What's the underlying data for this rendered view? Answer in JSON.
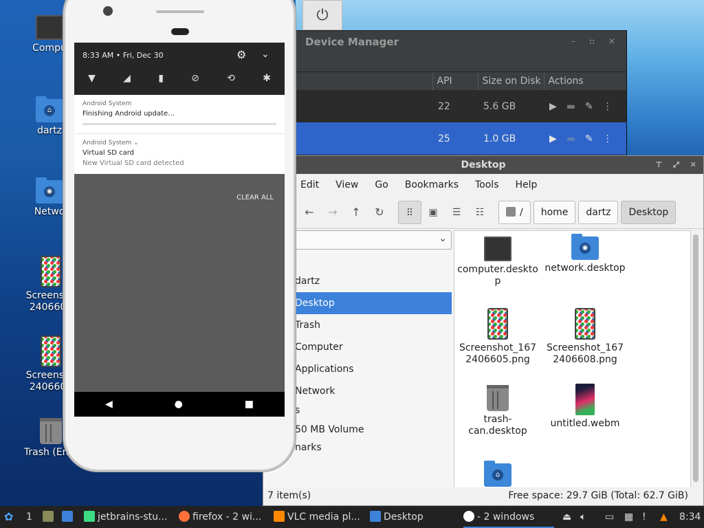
{
  "desktop": {
    "icons": [
      {
        "label": "Compu",
        "kind": "computer"
      },
      {
        "label": "dartz",
        "kind": "home-folder"
      },
      {
        "label": "Netwo",
        "kind": "network-folder"
      },
      {
        "label": "Screensho",
        "label2": "2406605",
        "kind": "image"
      },
      {
        "label": "Screensho",
        "label2": "2406608",
        "kind": "image"
      },
      {
        "label": "Trash (Emp",
        "kind": "trash"
      }
    ]
  },
  "device_manager": {
    "title": "Device Manager",
    "columns": [
      "API",
      "Size on Disk",
      "Actions"
    ],
    "rows": [
      {
        "api": "22",
        "size": "5.6 GB"
      },
      {
        "api": "25",
        "size": "1.0 GB",
        "selected": true
      }
    ]
  },
  "power_icon": "⏻",
  "file_manager": {
    "title": "Desktop",
    "menu": [
      "Edit",
      "View",
      "Go",
      "Bookmarks",
      "Tools",
      "Help"
    ],
    "breadcrumbs": [
      "/",
      "home",
      "dartz",
      "Desktop"
    ],
    "sidebar": [
      {
        "label": "dartz"
      },
      {
        "label": "Desktop",
        "selected": true
      },
      {
        "label": "Trash"
      },
      {
        "label": "Computer"
      },
      {
        "label": "Applications"
      },
      {
        "label": "Network"
      },
      {
        "label": "s"
      },
      {
        "label": "50 MB Volume"
      },
      {
        "label": "narks"
      }
    ],
    "files": [
      {
        "name": "computer.deskto",
        "name2": "p",
        "kind": "computer"
      },
      {
        "name": "network.desktop",
        "name2": "",
        "kind": "network"
      },
      {
        "name": "Screenshot_167",
        "name2": "2406605.png",
        "kind": "image"
      },
      {
        "name": "Screenshot_167",
        "name2": "2406608.png",
        "kind": "image"
      },
      {
        "name": "trash-",
        "name2": "can.desktop",
        "kind": "trash"
      },
      {
        "name": "untitled.webm",
        "name2": "",
        "kind": "video"
      },
      {
        "name": "",
        "name2": "",
        "kind": "home-folder"
      }
    ],
    "status_left": "7 item(s)",
    "status_right": "Free space: 29.7 GiB (Total: 62.7 GiB)"
  },
  "phone": {
    "status_time": "8:33 AM • Fri, Dec 30",
    "notifications": [
      {
        "app": "Android System",
        "title": "Finishing Android update…",
        "has_progress": true
      },
      {
        "app": "Android System ⌄",
        "title": "Virtual SD card",
        "subtitle": "New Virtual SD card detected"
      }
    ],
    "clear_all": "CLEAR ALL"
  },
  "taskbar": {
    "workspace": "1",
    "items": [
      {
        "label": "jetbrains-stu...",
        "color": "#3ddc84"
      },
      {
        "label": "firefox - 2 wi...",
        "color": "#ff7139"
      },
      {
        "label": "VLC media pl...",
        "color": "#ff8800"
      },
      {
        "label": "Desktop",
        "color": "#3c82da"
      },
      {
        "label": "- 2 windows",
        "color": "#ffffff"
      }
    ],
    "clock": "8:34"
  }
}
